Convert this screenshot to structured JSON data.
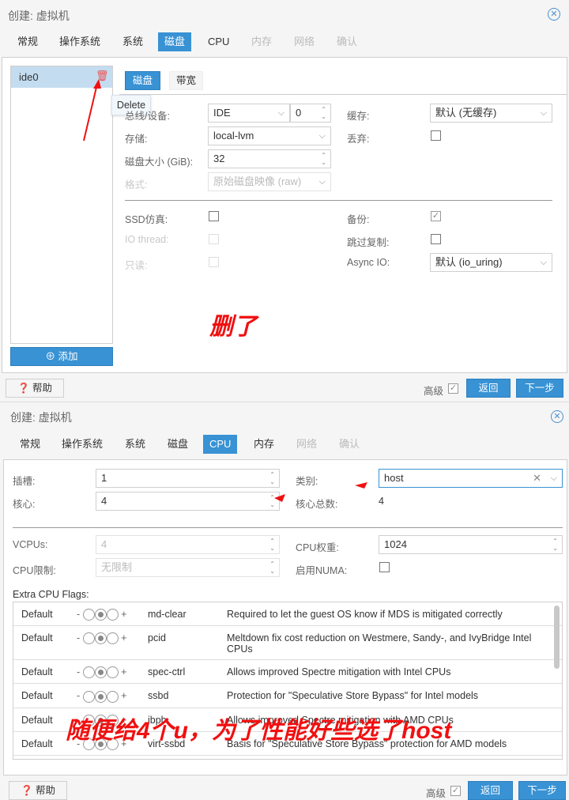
{
  "dialog1": {
    "title": "创建: 虚拟机",
    "tabs": [
      "常规",
      "操作系统",
      "系统",
      "磁盘",
      "CPU",
      "内存",
      "网络",
      "确认"
    ],
    "disk_list": {
      "item": "ide0",
      "add_label": "添加",
      "tooltip": "Delete"
    },
    "subtabs": [
      "磁盘",
      "带宽"
    ],
    "fields": {
      "bus_label": "总线/设备:",
      "bus_value": "IDE",
      "bus_index": "0",
      "storage_label": "存储:",
      "storage_value": "local-lvm",
      "size_label": "磁盘大小 (GiB):",
      "size_value": "32",
      "format_label": "格式:",
      "format_value": "原始磁盘映像 (raw)",
      "cache_label": "缓存:",
      "cache_value": "默认 (无缓存)",
      "discard_label": "丢弃:",
      "ssd_label": "SSD仿真:",
      "iothread_label": "IO thread:",
      "readonly_label": "只读:",
      "backup_label": "备份:",
      "skiprep_label": "跳过复制:",
      "asyncio_label": "Async IO:",
      "asyncio_value": "默认 (io_uring)"
    },
    "annotation": "删了",
    "footer": {
      "help": "帮助",
      "advanced": "高级",
      "back": "返回",
      "next": "下一步"
    }
  },
  "dialog2": {
    "title": "创建: 虚拟机",
    "tabs": [
      "常规",
      "操作系统",
      "系统",
      "磁盘",
      "CPU",
      "内存",
      "网络",
      "确认"
    ],
    "fields": {
      "sockets_label": "插槽:",
      "sockets_value": "1",
      "cores_label": "核心:",
      "cores_value": "4",
      "type_label": "类别:",
      "type_value": "host",
      "total_label": "核心总数:",
      "total_value": "4",
      "vcpus_label": "VCPUs:",
      "vcpus_value": "4",
      "limit_label": "CPU限制:",
      "limit_value": "无限制",
      "weight_label": "CPU权重:",
      "weight_value": "1024",
      "numa_label": "启用NUMA:"
    },
    "flags_label": "Extra CPU Flags:",
    "flags": [
      {
        "state": "Default",
        "name": "md-clear",
        "desc": "Required to let the guest OS know if MDS is mitigated correctly"
      },
      {
        "state": "Default",
        "name": "pcid",
        "desc": "Meltdown fix cost reduction on Westmere, Sandy-, and IvyBridge Intel CPUs"
      },
      {
        "state": "Default",
        "name": "spec-ctrl",
        "desc": "Allows improved Spectre mitigation with Intel CPUs"
      },
      {
        "state": "Default",
        "name": "ssbd",
        "desc": "Protection for \"Speculative Store Bypass\" for Intel models"
      },
      {
        "state": "Default",
        "name": "ibpb",
        "desc": "Allows improved Spectre mitigation with AMD CPUs"
      },
      {
        "state": "Default",
        "name": "virt-ssbd",
        "desc": "Basis for \"Speculative Store Bypass\" protection for AMD models"
      }
    ],
    "annotation": "随便给4个u，为了性能好些选了host",
    "footer": {
      "help": "帮助",
      "advanced": "高级",
      "back": "返回",
      "next": "下一步"
    }
  }
}
